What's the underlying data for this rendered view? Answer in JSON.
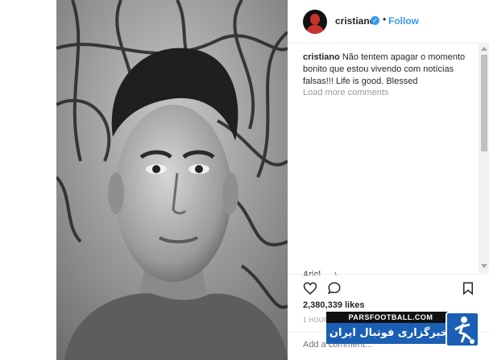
{
  "post": {
    "username": "cristiano",
    "verified_icon": "verified-badge-icon",
    "separator": "•",
    "follow_label": "Follow",
    "caption_user": "cristiano",
    "caption_text": "Não tentem apagar o momento bonito que estou vivendo com notícias falsas!!! Life is good. Blessed",
    "load_more_label": "Load more comments",
    "cut_comment": "Ariel ... ♪",
    "likes": "2,380,339 likes",
    "time_ago": "1 HOUR AGO",
    "comment_placeholder": "Add a comment..."
  },
  "icons": {
    "like": "heart-icon",
    "comment": "comment-bubble-icon",
    "save": "bookmark-icon"
  },
  "watermark": {
    "top_text": "PARSFOOTBALL.COM",
    "main_text": "خبرگزاری فوتبال ایران"
  },
  "colors": {
    "accent": "#3897f0",
    "watermark_blue": "#1a5fb4",
    "text": "#262626",
    "muted": "#999999"
  }
}
